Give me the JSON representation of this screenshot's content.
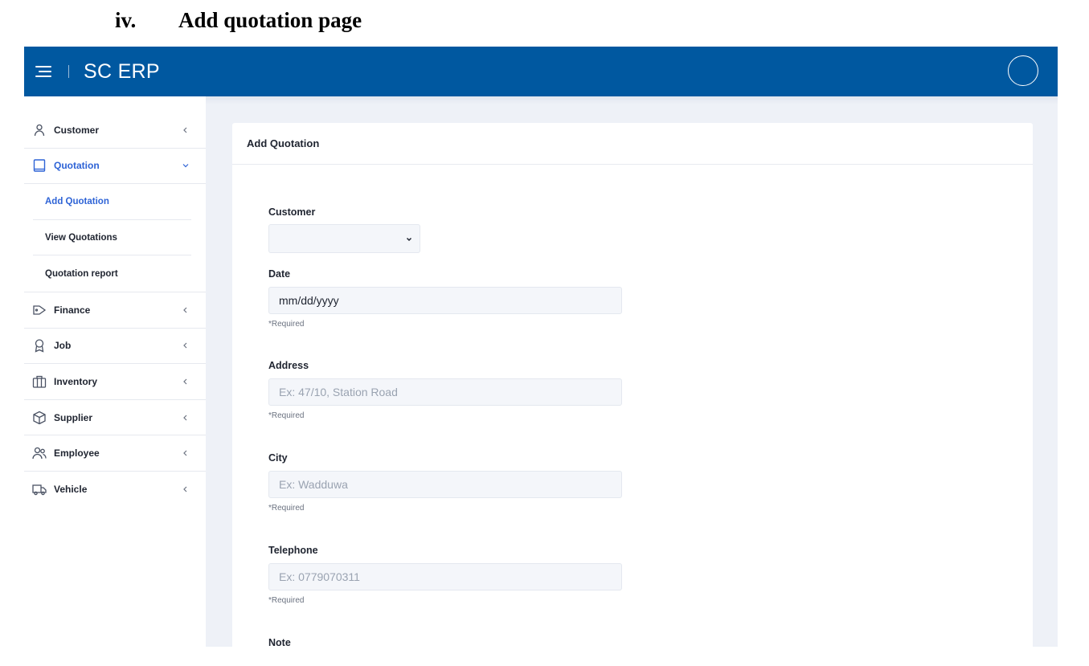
{
  "doc_heading": {
    "number": "iv.",
    "title": "Add quotation page"
  },
  "app": {
    "brand": "SC ERP"
  },
  "sidebar": {
    "items": [
      {
        "label": "Customer",
        "icon": "user-icon"
      },
      {
        "label": "Quotation",
        "icon": "book-icon",
        "expanded": true,
        "active": true,
        "children": [
          {
            "label": "Add Quotation",
            "active": true
          },
          {
            "label": "View Quotations"
          },
          {
            "label": "Quotation report"
          }
        ]
      },
      {
        "label": "Finance",
        "icon": "tag-icon"
      },
      {
        "label": "Job",
        "icon": "award-icon"
      },
      {
        "label": "Inventory",
        "icon": "briefcase-icon"
      },
      {
        "label": "Supplier",
        "icon": "box-icon"
      },
      {
        "label": "Employee",
        "icon": "users-icon"
      },
      {
        "label": "Vehicle",
        "icon": "truck-icon"
      }
    ]
  },
  "card": {
    "title": "Add Quotation",
    "fields": {
      "customer": {
        "label": "Customer",
        "value": ""
      },
      "date": {
        "label": "Date",
        "value": "mm/dd/yyyy",
        "hint": "*Required"
      },
      "address": {
        "label": "Address",
        "placeholder": "Ex: 47/10, Station Road",
        "hint": "*Required"
      },
      "city": {
        "label": "City",
        "placeholder": "Ex: Wadduwa",
        "hint": "*Required"
      },
      "telephone": {
        "label": "Telephone",
        "placeholder": "Ex: 0779070311",
        "hint": "*Required"
      },
      "note": {
        "label": "Note"
      }
    }
  },
  "colors": {
    "topbar": "#0058a0",
    "accent": "#2e63d6",
    "content_bg": "#eef1f7"
  }
}
